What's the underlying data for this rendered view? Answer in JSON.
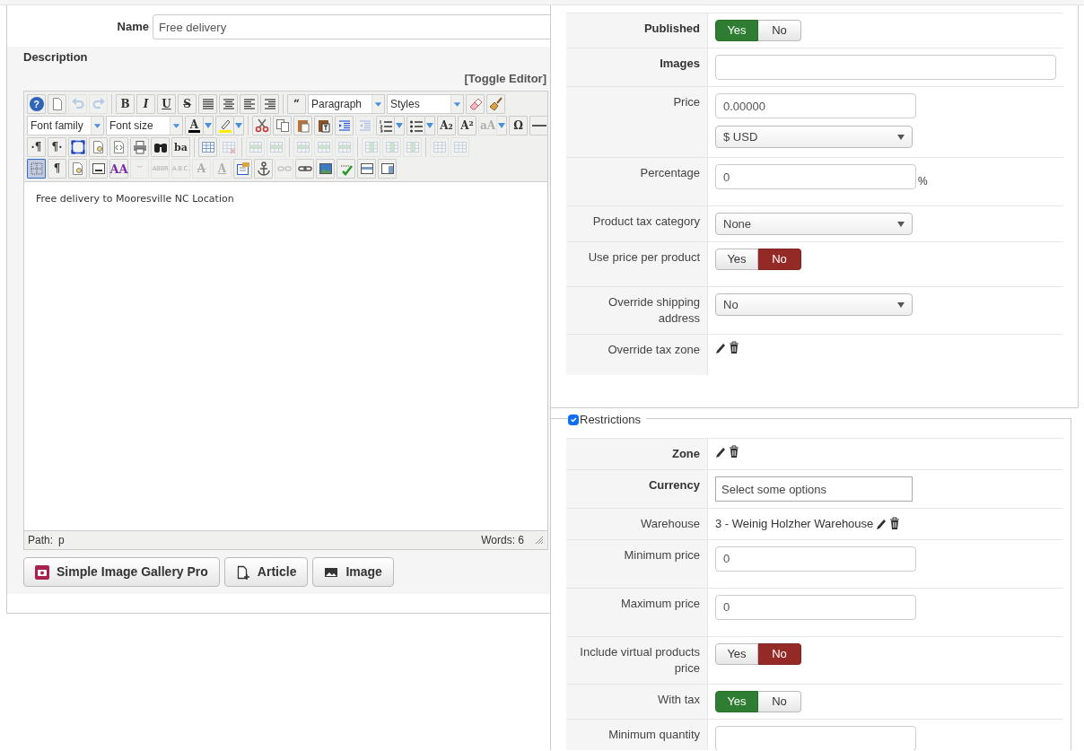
{
  "name_field": {
    "label": "Name",
    "value": "Free delivery"
  },
  "description": {
    "label": "Description",
    "toggle_link": "[Toggle Editor]"
  },
  "editor": {
    "toolbar": [
      [
        [
          {
            "kind": "help",
            "glyph": "?",
            "disabled": false,
            "on": false
          },
          {
            "kind": "doc",
            "disabled": false,
            "on": false
          },
          {
            "kind": "undo",
            "disabled": true,
            "on": false
          },
          {
            "kind": "redo",
            "disabled": true,
            "on": false
          }
        ],
        [
          {
            "kind": "glyph",
            "glyph": "B",
            "disabled": false,
            "on": false
          },
          {
            "kind": "glyph-italic",
            "glyph": "I",
            "disabled": false,
            "on": false
          },
          {
            "kind": "glyph-underline",
            "glyph": "U",
            "disabled": false,
            "on": false
          },
          {
            "kind": "glyph-strike",
            "glyph": "S",
            "disabled": false,
            "on": false
          },
          {
            "kind": "justify",
            "disabled": false,
            "on": false
          },
          {
            "kind": "center",
            "disabled": false,
            "on": false
          },
          {
            "kind": "left",
            "disabled": false,
            "on": false
          },
          {
            "kind": "right",
            "disabled": false,
            "on": false
          }
        ],
        [
          {
            "kind": "glyph",
            "glyph": "“",
            "disabled": false,
            "on": false
          },
          {
            "kind": "select",
            "value": "Paragraph"
          },
          {
            "kind": "select",
            "value": "Styles"
          },
          {
            "kind": "eraser",
            "disabled": false,
            "on": false
          },
          {
            "kind": "broom",
            "disabled": false,
            "on": false
          }
        ]
      ],
      [
        [
          {
            "kind": "select",
            "value": "Font family"
          },
          {
            "kind": "select",
            "value": "Font size"
          },
          {
            "kind": "forecolor",
            "glyph": "A",
            "disabled": false,
            "on": false
          },
          {
            "kind": "hilite",
            "disabled": false,
            "on": false
          }
        ],
        [
          {
            "kind": "cut",
            "disabled": false,
            "on": false
          },
          {
            "kind": "copy",
            "disabled": false,
            "on": false
          },
          {
            "kind": "paste",
            "disabled": false,
            "on": false
          },
          {
            "kind": "pastetext",
            "disabled": false,
            "on": false
          },
          {
            "kind": "indent",
            "disabled": false,
            "on": false
          },
          {
            "kind": "outdent",
            "disabled": true,
            "on": false
          },
          {
            "kind": "ol",
            "disabled": false,
            "on": false
          },
          {
            "kind": "ul",
            "disabled": false,
            "on": false
          },
          {
            "kind": "glyph",
            "glyph": "A₂",
            "disabled": false,
            "on": false
          },
          {
            "kind": "glyph",
            "glyph": "A²",
            "disabled": false,
            "on": false
          },
          {
            "kind": "charstyle",
            "glyph": "aA",
            "disabled": true,
            "on": false
          },
          {
            "kind": "glyph",
            "glyph": "Ω",
            "disabled": false,
            "on": false
          },
          {
            "kind": "hr",
            "disabled": false,
            "on": false
          }
        ]
      ],
      [
        [
          {
            "kind": "glyph",
            "glyph": "·¶",
            "disabled": false,
            "on": false
          },
          {
            "kind": "glyph",
            "glyph": "¶·",
            "disabled": false,
            "on": false
          },
          {
            "kind": "fullscreen",
            "disabled": false,
            "on": false
          },
          {
            "kind": "preview",
            "disabled": false,
            "on": false
          },
          {
            "kind": "code",
            "disabled": false,
            "on": false
          },
          {
            "kind": "print",
            "disabled": false,
            "on": false
          },
          {
            "kind": "find",
            "disabled": false,
            "on": false
          },
          {
            "kind": "glyph-small",
            "glyph": "ba",
            "disabled": false,
            "on": false
          }
        ],
        [
          {
            "kind": "table",
            "disabled": false,
            "on": false
          },
          {
            "kind": "tabledel",
            "disabled": true,
            "on": false
          }
        ],
        [
          {
            "kind": "rowop",
            "disabled": true,
            "on": false
          },
          {
            "kind": "rowop",
            "disabled": true,
            "on": false
          }
        ],
        [
          {
            "kind": "rowop",
            "disabled": true,
            "on": false
          },
          {
            "kind": "rowop",
            "disabled": true,
            "on": false
          },
          {
            "kind": "rowop",
            "disabled": true,
            "on": false
          }
        ],
        [
          {
            "kind": "colop",
            "disabled": true,
            "on": false
          },
          {
            "kind": "colop",
            "disabled": true,
            "on": false
          },
          {
            "kind": "colop",
            "disabled": true,
            "on": false
          }
        ],
        [
          {
            "kind": "table",
            "disabled": true,
            "on": false
          },
          {
            "kind": "table",
            "disabled": true,
            "on": false
          }
        ]
      ],
      [
        [
          {
            "kind": "visualaid",
            "disabled": false,
            "on": true
          },
          {
            "kind": "glyph",
            "glyph": "¶",
            "disabled": false,
            "on": false
          },
          {
            "kind": "preview",
            "disabled": false,
            "on": false
          },
          {
            "kind": "pagebreak",
            "disabled": false,
            "on": false
          },
          {
            "kind": "glyph-color",
            "glyph": "AA",
            "disabled": false,
            "on": false
          },
          {
            "kind": "glyph-tiny",
            "glyph": "“”",
            "disabled": true,
            "on": false
          },
          {
            "kind": "glyph-tiny",
            "glyph": "ABBR",
            "disabled": true,
            "on": false
          },
          {
            "kind": "glyph-tiny",
            "glyph": "A.B.C.",
            "disabled": true,
            "on": false
          },
          {
            "kind": "glyph-strike",
            "glyph": "A",
            "disabled": true,
            "on": false
          },
          {
            "kind": "glyph-underline",
            "glyph": "A",
            "disabled": true,
            "on": false
          },
          {
            "kind": "attribs",
            "disabled": false,
            "on": false
          },
          {
            "kind": "anchor",
            "disabled": false,
            "on": false
          },
          {
            "kind": "unlink",
            "disabled": true,
            "on": false
          },
          {
            "kind": "link",
            "disabled": false,
            "on": false
          },
          {
            "kind": "image",
            "disabled": false,
            "on": false
          },
          {
            "kind": "spell",
            "disabled": false,
            "on": false
          },
          {
            "kind": "layer",
            "disabled": false,
            "on": false
          },
          {
            "kind": "panel",
            "disabled": false,
            "on": false
          }
        ]
      ]
    ],
    "content": "Free delivery to Mooresville NC Location",
    "path_label": "Path:",
    "path": "p",
    "words": "Words: 6"
  },
  "editor_buttons": [
    {
      "label": "Simple Image Gallery Pro",
      "kind": "gallery"
    },
    {
      "label": "Article",
      "kind": "article"
    },
    {
      "label": "Image",
      "kind": "image"
    }
  ],
  "details": [
    {
      "label": "Published",
      "bold": true,
      "kind": "toggle",
      "options": [
        {
          "label": "Yes",
          "selected": true
        },
        {
          "label": "No",
          "selected": false
        }
      ]
    },
    {
      "label": "Images",
      "bold": true,
      "kind": "input",
      "wide": true
    },
    {
      "label": "Price",
      "bold": false,
      "kind": "price",
      "value": "0.00000",
      "currency": "$ USD"
    },
    {
      "label": "Percentage",
      "bold": false,
      "kind": "input",
      "value": "0",
      "suffix": "%"
    },
    {
      "label": "Product tax category",
      "bold": false,
      "kind": "select",
      "value": "None"
    },
    {
      "label": "Use price per product",
      "bold": false,
      "kind": "toggle",
      "options": [
        {
          "label": "Yes",
          "selected": false
        },
        {
          "label": "No",
          "selected": true
        }
      ]
    },
    {
      "label": "Override shipping address",
      "bold": false,
      "kind": "select",
      "value": "No"
    },
    {
      "label": "Override tax zone",
      "bold": false,
      "kind": "edit-icons"
    }
  ],
  "restrictions": {
    "legend": "Restrictions",
    "checked": true,
    "rows": [
      {
        "label": "Zone",
        "bold": true,
        "kind": "edit-icons"
      },
      {
        "label": "Currency",
        "bold": true,
        "kind": "multiselect",
        "placeholder": "Select some options"
      },
      {
        "label": "Warehouse",
        "bold": false,
        "kind": "text-icons",
        "text": "3 - Weinig Holzher Warehouse"
      },
      {
        "label": "Minimum price",
        "bold": false,
        "kind": "input",
        "value": "0"
      },
      {
        "label": "Maximum price",
        "bold": false,
        "kind": "input",
        "value": "0"
      },
      {
        "label": "Include virtual products price",
        "bold": false,
        "kind": "toggle",
        "options": [
          {
            "label": "Yes",
            "selected": false
          },
          {
            "label": "No",
            "selected": true
          }
        ]
      },
      {
        "label": "With tax",
        "bold": false,
        "kind": "toggle",
        "options": [
          {
            "label": "Yes",
            "selected": true
          },
          {
            "label": "No",
            "selected": false
          }
        ]
      },
      {
        "label": "Minimum quantity",
        "bold": false,
        "kind": "input"
      }
    ]
  }
}
